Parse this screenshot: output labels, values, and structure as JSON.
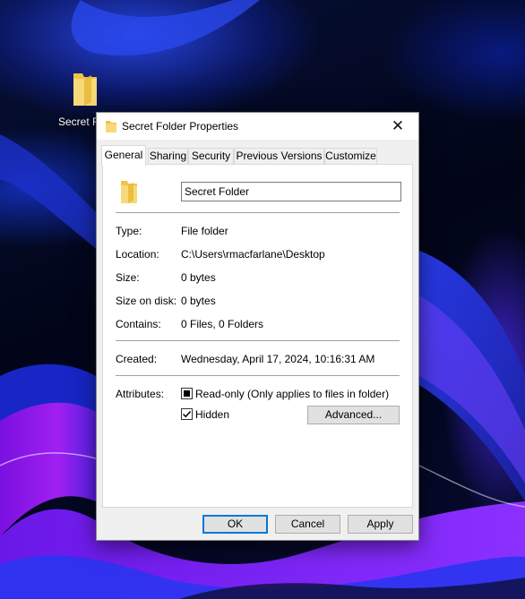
{
  "desktop": {
    "icon_label": "Secret F"
  },
  "window": {
    "title": "Secret Folder Properties",
    "close_glyph": "✕",
    "tabs": [
      {
        "label": "General",
        "active": true
      },
      {
        "label": "Sharing",
        "active": false
      },
      {
        "label": "Security",
        "active": false
      },
      {
        "label": "Previous Versions",
        "active": false
      },
      {
        "label": "Customize",
        "active": false
      }
    ]
  },
  "general": {
    "folder_name": "Secret Folder",
    "type_label": "Type:",
    "type_value": "File folder",
    "location_label": "Location:",
    "location_value": "C:\\Users\\rmacfarlane\\Desktop",
    "size_label": "Size:",
    "size_value": "0 bytes",
    "size_on_disk_label": "Size on disk:",
    "size_on_disk_value": "0 bytes",
    "contains_label": "Contains:",
    "contains_value": "0 Files, 0 Folders",
    "created_label": "Created:",
    "created_value": "Wednesday, April 17, 2024, 10:16:31 AM",
    "attributes_label": "Attributes:",
    "readonly_label": "Read-only (Only applies to files in folder)",
    "readonly_state": "indeterminate",
    "hidden_label": "Hidden",
    "hidden_state": "checked",
    "advanced_button": "Advanced..."
  },
  "footer": {
    "ok_label": "OK",
    "cancel_label": "Cancel",
    "apply_label": "Apply"
  },
  "colors": {
    "folder": "#f5d36b",
    "default_button_border": "#0078d7",
    "wallpaper_accent_blue": "#1f3ce0",
    "wallpaper_accent_purple": "#8a1be8"
  },
  "icons": [
    "folder-icon",
    "close-icon",
    "checkbox-indeterminate-icon",
    "checkmark-icon"
  ]
}
